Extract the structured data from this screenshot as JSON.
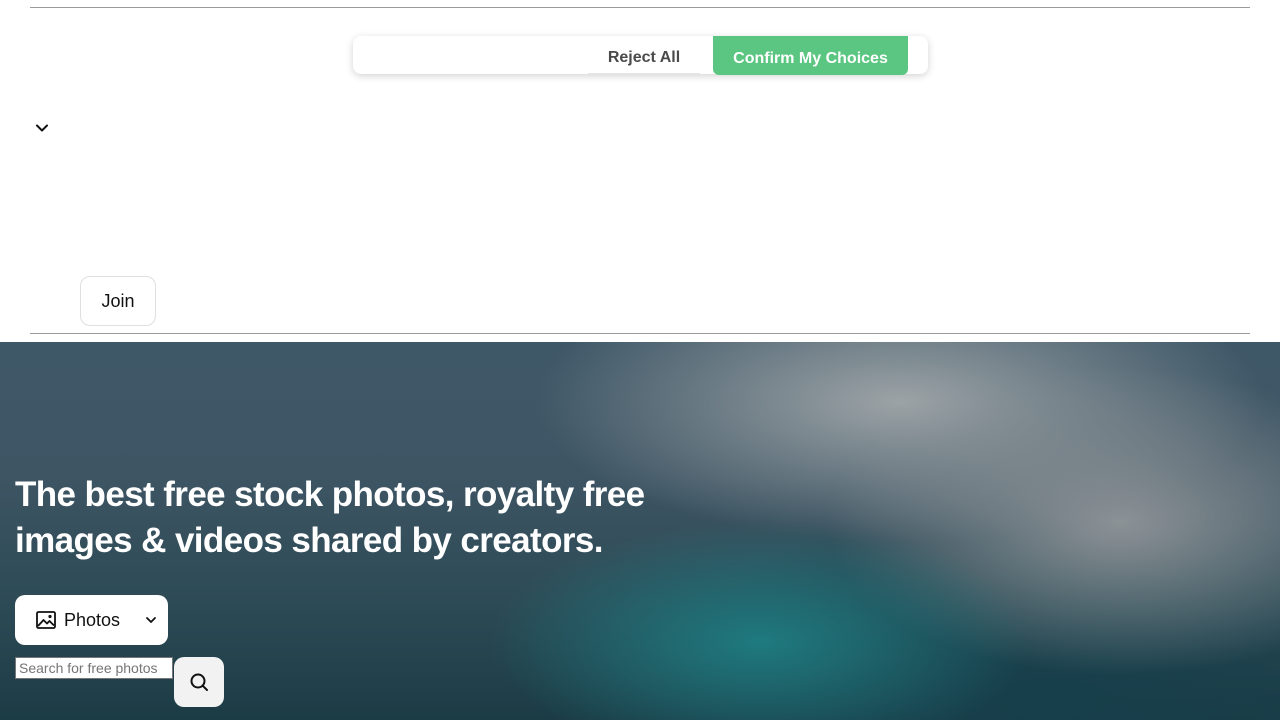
{
  "consent": {
    "reject_label": "Reject All",
    "confirm_label": "Confirm My Choices",
    "confirm_color": "#5bc681"
  },
  "header": {
    "join_label": "Join",
    "expand_icon": "chevron-down-icon"
  },
  "hero": {
    "headline": "The best free stock photos, royalty free images & videos shared by creators.",
    "media_type": {
      "selected": "Photos",
      "icon": "image-icon"
    },
    "search": {
      "placeholder": "Search for free photos",
      "button_icon": "search-icon"
    }
  }
}
